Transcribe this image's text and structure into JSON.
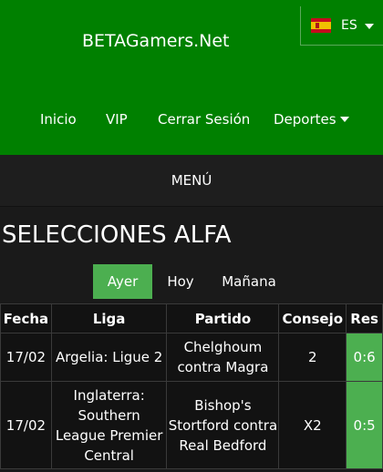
{
  "header": {
    "brand": "BETAGamers.Net",
    "language": {
      "code": "ES",
      "flag_icon": "spain-flag-icon"
    },
    "nav": {
      "inicio": "Inicio",
      "vip": "VIP",
      "cerrar_sesion": "Cerrar Sesión",
      "deportes": "Deportes"
    }
  },
  "menu": {
    "label": "MENÚ"
  },
  "section": {
    "title": "SELECCIONES ALFA"
  },
  "tabs": {
    "ayer": "Ayer",
    "hoy": "Hoy",
    "manana": "Mañana",
    "active": "Ayer"
  },
  "table": {
    "headers": {
      "fecha": "Fecha",
      "liga": "Liga",
      "partido": "Partido",
      "consejo": "Consejo",
      "res": "Res"
    },
    "rows": [
      {
        "fecha": "17/02",
        "liga": "Argelia: Ligue 2",
        "partido": "Chelghoum contra Magra",
        "consejo": "2",
        "res": "0:6"
      },
      {
        "fecha": "17/02",
        "liga": "Inglaterra: Southern League Premier Central",
        "partido": "Bishop's Stortford contra Real Bedford",
        "consejo": "X2",
        "res": "0:5"
      }
    ]
  },
  "colors": {
    "header_bg": "#008000",
    "accent": "#4caf50",
    "page_bg": "#1a1a1a"
  }
}
